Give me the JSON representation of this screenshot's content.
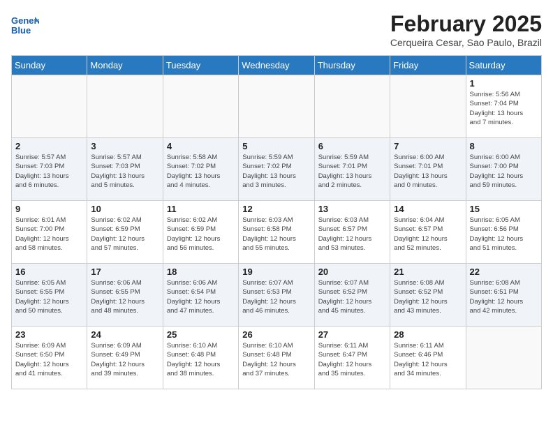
{
  "header": {
    "logo_line1": "General",
    "logo_line2": "Blue",
    "month_title": "February 2025",
    "location": "Cerqueira Cesar, Sao Paulo, Brazil"
  },
  "days_of_week": [
    "Sunday",
    "Monday",
    "Tuesday",
    "Wednesday",
    "Thursday",
    "Friday",
    "Saturday"
  ],
  "weeks": [
    {
      "shade": false,
      "days": [
        {
          "num": "",
          "info": ""
        },
        {
          "num": "",
          "info": ""
        },
        {
          "num": "",
          "info": ""
        },
        {
          "num": "",
          "info": ""
        },
        {
          "num": "",
          "info": ""
        },
        {
          "num": "",
          "info": ""
        },
        {
          "num": "1",
          "info": "Sunrise: 5:56 AM\nSunset: 7:04 PM\nDaylight: 13 hours\nand 7 minutes."
        }
      ]
    },
    {
      "shade": true,
      "days": [
        {
          "num": "2",
          "info": "Sunrise: 5:57 AM\nSunset: 7:03 PM\nDaylight: 13 hours\nand 6 minutes."
        },
        {
          "num": "3",
          "info": "Sunrise: 5:57 AM\nSunset: 7:03 PM\nDaylight: 13 hours\nand 5 minutes."
        },
        {
          "num": "4",
          "info": "Sunrise: 5:58 AM\nSunset: 7:02 PM\nDaylight: 13 hours\nand 4 minutes."
        },
        {
          "num": "5",
          "info": "Sunrise: 5:59 AM\nSunset: 7:02 PM\nDaylight: 13 hours\nand 3 minutes."
        },
        {
          "num": "6",
          "info": "Sunrise: 5:59 AM\nSunset: 7:01 PM\nDaylight: 13 hours\nand 2 minutes."
        },
        {
          "num": "7",
          "info": "Sunrise: 6:00 AM\nSunset: 7:01 PM\nDaylight: 13 hours\nand 0 minutes."
        },
        {
          "num": "8",
          "info": "Sunrise: 6:00 AM\nSunset: 7:00 PM\nDaylight: 12 hours\nand 59 minutes."
        }
      ]
    },
    {
      "shade": false,
      "days": [
        {
          "num": "9",
          "info": "Sunrise: 6:01 AM\nSunset: 7:00 PM\nDaylight: 12 hours\nand 58 minutes."
        },
        {
          "num": "10",
          "info": "Sunrise: 6:02 AM\nSunset: 6:59 PM\nDaylight: 12 hours\nand 57 minutes."
        },
        {
          "num": "11",
          "info": "Sunrise: 6:02 AM\nSunset: 6:59 PM\nDaylight: 12 hours\nand 56 minutes."
        },
        {
          "num": "12",
          "info": "Sunrise: 6:03 AM\nSunset: 6:58 PM\nDaylight: 12 hours\nand 55 minutes."
        },
        {
          "num": "13",
          "info": "Sunrise: 6:03 AM\nSunset: 6:57 PM\nDaylight: 12 hours\nand 53 minutes."
        },
        {
          "num": "14",
          "info": "Sunrise: 6:04 AM\nSunset: 6:57 PM\nDaylight: 12 hours\nand 52 minutes."
        },
        {
          "num": "15",
          "info": "Sunrise: 6:05 AM\nSunset: 6:56 PM\nDaylight: 12 hours\nand 51 minutes."
        }
      ]
    },
    {
      "shade": true,
      "days": [
        {
          "num": "16",
          "info": "Sunrise: 6:05 AM\nSunset: 6:55 PM\nDaylight: 12 hours\nand 50 minutes."
        },
        {
          "num": "17",
          "info": "Sunrise: 6:06 AM\nSunset: 6:55 PM\nDaylight: 12 hours\nand 48 minutes."
        },
        {
          "num": "18",
          "info": "Sunrise: 6:06 AM\nSunset: 6:54 PM\nDaylight: 12 hours\nand 47 minutes."
        },
        {
          "num": "19",
          "info": "Sunrise: 6:07 AM\nSunset: 6:53 PM\nDaylight: 12 hours\nand 46 minutes."
        },
        {
          "num": "20",
          "info": "Sunrise: 6:07 AM\nSunset: 6:52 PM\nDaylight: 12 hours\nand 45 minutes."
        },
        {
          "num": "21",
          "info": "Sunrise: 6:08 AM\nSunset: 6:52 PM\nDaylight: 12 hours\nand 43 minutes."
        },
        {
          "num": "22",
          "info": "Sunrise: 6:08 AM\nSunset: 6:51 PM\nDaylight: 12 hours\nand 42 minutes."
        }
      ]
    },
    {
      "shade": false,
      "days": [
        {
          "num": "23",
          "info": "Sunrise: 6:09 AM\nSunset: 6:50 PM\nDaylight: 12 hours\nand 41 minutes."
        },
        {
          "num": "24",
          "info": "Sunrise: 6:09 AM\nSunset: 6:49 PM\nDaylight: 12 hours\nand 39 minutes."
        },
        {
          "num": "25",
          "info": "Sunrise: 6:10 AM\nSunset: 6:48 PM\nDaylight: 12 hours\nand 38 minutes."
        },
        {
          "num": "26",
          "info": "Sunrise: 6:10 AM\nSunset: 6:48 PM\nDaylight: 12 hours\nand 37 minutes."
        },
        {
          "num": "27",
          "info": "Sunrise: 6:11 AM\nSunset: 6:47 PM\nDaylight: 12 hours\nand 35 minutes."
        },
        {
          "num": "28",
          "info": "Sunrise: 6:11 AM\nSunset: 6:46 PM\nDaylight: 12 hours\nand 34 minutes."
        },
        {
          "num": "",
          "info": ""
        }
      ]
    }
  ]
}
